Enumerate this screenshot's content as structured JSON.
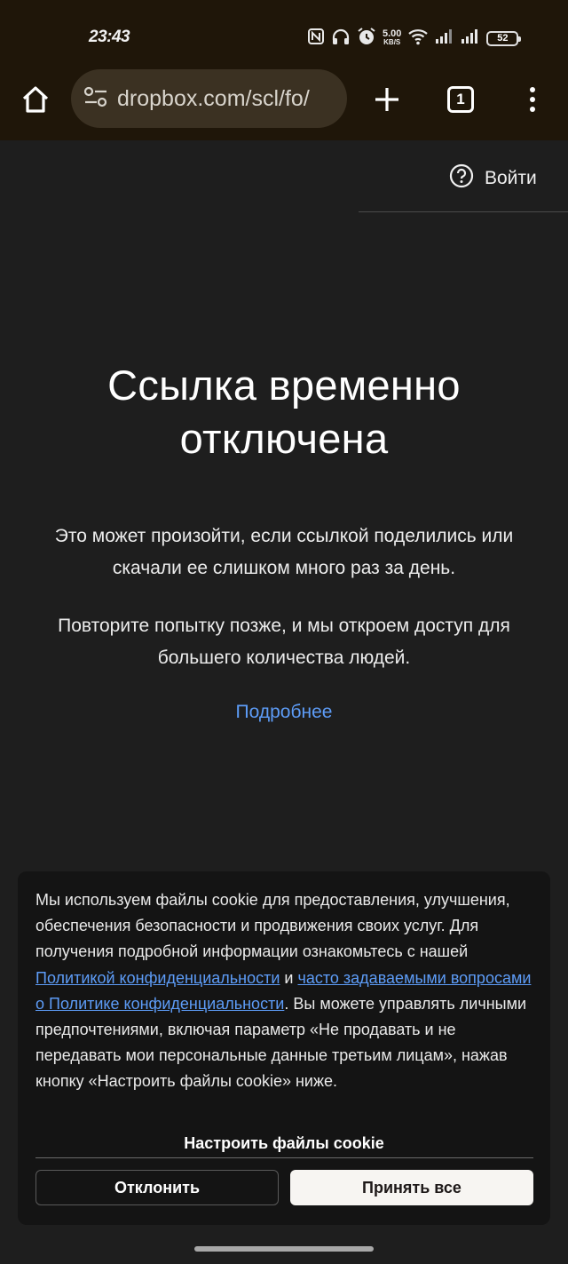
{
  "status_bar": {
    "time": "23:43",
    "net_speed_value": "5.00",
    "net_speed_unit": "KB/S",
    "battery_level": "52",
    "icons": [
      "nfc-icon",
      "headphones-icon",
      "alarm-icon",
      "wifi-icon",
      "signal-icon",
      "signal-icon",
      "battery-icon"
    ]
  },
  "browser": {
    "url": "dropbox.com/scl/fo/",
    "home_icon": "home-icon",
    "site_settings_icon": "site-settings-icon",
    "new_tab_icon": "plus-icon",
    "tabs_icon": "tabs-icon",
    "tabs_count": "1",
    "menu_icon": "more-vert-icon"
  },
  "header": {
    "help_icon": "help-icon",
    "sign_in_label": "Войти"
  },
  "main": {
    "title_line1": "Ссылка временно",
    "title_line2": "отключена",
    "para1_line1": "Это может произойти, если ссылкой поделились или",
    "para1_line2": "скачали ее слишком много раз за день.",
    "para2_line1": "Повторите попытку позже, и мы откроем доступ для",
    "para2_line2": "большего количества людей.",
    "more_link": "Подробнее"
  },
  "cookie_banner": {
    "text_part1": "Мы используем файлы cookie для предоставления, улучшения, обеспечения безопасности и продвижения своих услуг. Для получения подробной информации ознакомьтесь с нашей ",
    "privacy_link": "Политикой конфиденциальности",
    "text_part2": " и ",
    "faq_link": "часто задаваемыми вопросами о Политике конфиденциальности",
    "text_part3": ". Вы можете управлять личными предпочтениями, включая параметр «Не продавать и не передавать мои персональные данные третьим лицам», нажав кнопку «Настроить файлы cookie» ниже.",
    "configure_label": "Настроить файлы cookie",
    "decline_label": "Отклонить",
    "accept_label": "Принять все"
  },
  "colors": {
    "page_bg": "#1e1e1e",
    "toolbar_bg": "#1f1609",
    "url_pill_bg": "#3b3122",
    "link": "#5d9cf7",
    "panel_bg": "#141414",
    "accept_bg": "#f7f5f2"
  }
}
